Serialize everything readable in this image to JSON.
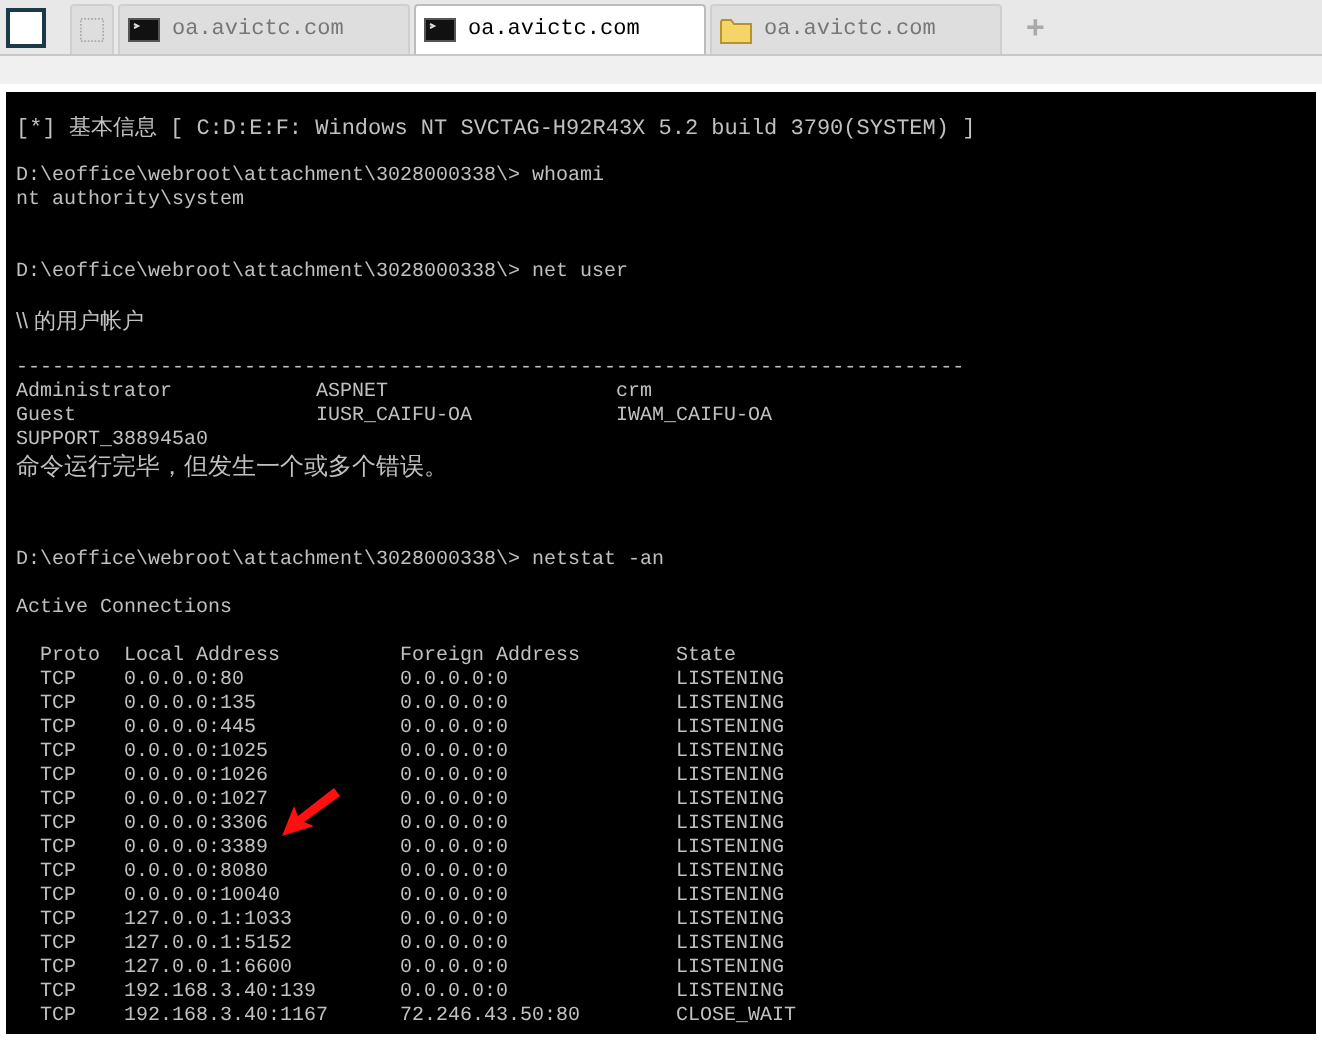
{
  "tabs": [
    {
      "kind": "blank",
      "selected": false
    },
    {
      "kind": "terminal",
      "label": "oa.avictc.com",
      "selected": false
    },
    {
      "kind": "terminal",
      "label": "oa.avictc.com",
      "selected": true
    },
    {
      "kind": "folder",
      "label": "oa.avictc.com",
      "selected": false
    }
  ],
  "new_tab": "+",
  "terminal": {
    "banner": "[*] 基本信息 [ C:D:E:F: Windows NT SVCTAG-H92R43X 5.2 build 3790(SYSTEM) ]",
    "whoami": {
      "prompt": "D:\\eoffice\\webroot\\attachment\\3028000338\\>",
      "command": "whoami",
      "output": "nt authority\\system"
    },
    "net_user": {
      "prompt": "D:\\eoffice\\webroot\\attachment\\3028000338\\>",
      "command": "net user",
      "heading": "\\\\ 的用户帐户",
      "separator": "-------------------------------------------------------------------------------",
      "users": [
        [
          "Administrator",
          "ASPNET",
          "crm"
        ],
        [
          "Guest",
          "IUSR_CAIFU-OA",
          "IWAM_CAIFU-OA"
        ],
        [
          "SUPPORT_388945a0"
        ]
      ],
      "message": "命令运行完毕，但发生一个或多个错误。"
    },
    "netstat": {
      "prompt": "D:\\eoffice\\webroot\\attachment\\3028000338\\>",
      "command": "netstat -an",
      "heading": "Active Connections",
      "columns": [
        "Proto",
        "Local Address",
        "Foreign Address",
        "State"
      ],
      "rows": [
        [
          "TCP",
          "0.0.0.0:80",
          "0.0.0.0:0",
          "LISTENING"
        ],
        [
          "TCP",
          "0.0.0.0:135",
          "0.0.0.0:0",
          "LISTENING"
        ],
        [
          "TCP",
          "0.0.0.0:445",
          "0.0.0.0:0",
          "LISTENING"
        ],
        [
          "TCP",
          "0.0.0.0:1025",
          "0.0.0.0:0",
          "LISTENING"
        ],
        [
          "TCP",
          "0.0.0.0:1026",
          "0.0.0.0:0",
          "LISTENING"
        ],
        [
          "TCP",
          "0.0.0.0:1027",
          "0.0.0.0:0",
          "LISTENING"
        ],
        [
          "TCP",
          "0.0.0.0:3306",
          "0.0.0.0:0",
          "LISTENING"
        ],
        [
          "TCP",
          "0.0.0.0:3389",
          "0.0.0.0:0",
          "LISTENING"
        ],
        [
          "TCP",
          "0.0.0.0:8080",
          "0.0.0.0:0",
          "LISTENING"
        ],
        [
          "TCP",
          "0.0.0.0:10040",
          "0.0.0.0:0",
          "LISTENING"
        ],
        [
          "TCP",
          "127.0.0.1:1033",
          "0.0.0.0:0",
          "LISTENING"
        ],
        [
          "TCP",
          "127.0.0.1:5152",
          "0.0.0.0:0",
          "LISTENING"
        ],
        [
          "TCP",
          "127.0.0.1:6600",
          "0.0.0.0:0",
          "LISTENING"
        ],
        [
          "TCP",
          "192.168.3.40:139",
          "0.0.0.0:0",
          "LISTENING"
        ],
        [
          "TCP",
          "192.168.3.40:1167",
          "72.246.43.50:80",
          "CLOSE_WAIT"
        ]
      ]
    }
  }
}
